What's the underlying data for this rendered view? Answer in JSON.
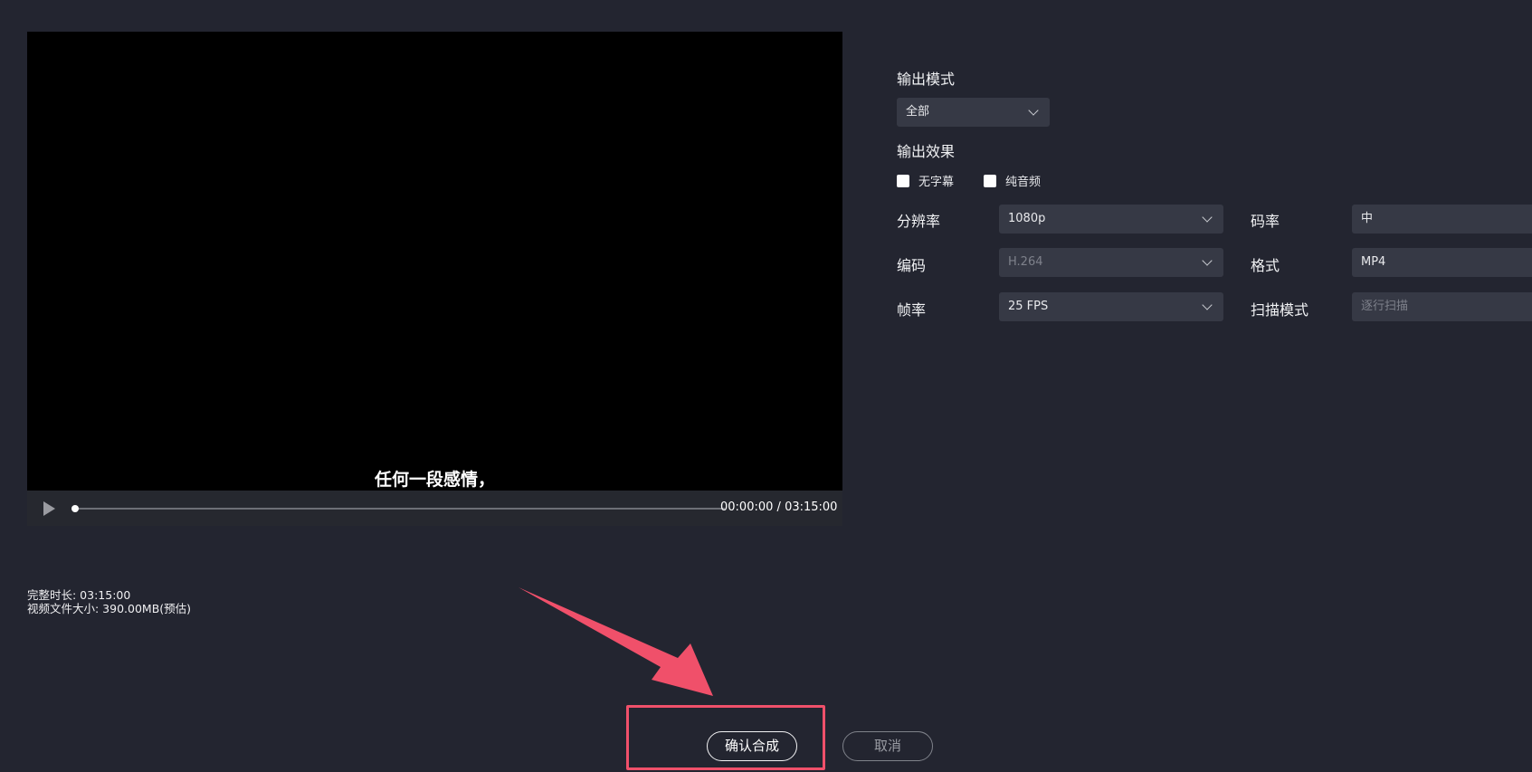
{
  "player": {
    "subtitle": "任何一段感情，",
    "time_current": "00:00:00",
    "time_separator": "/",
    "time_total": "03:15:00",
    "progress_fraction": 0.0
  },
  "info": {
    "duration": "完整时长: 03:15:00",
    "file_size": "视频文件大小: 390.00MB(预估)"
  },
  "settings": {
    "output_mode_label": "输出模式",
    "output_mode_value": "全部",
    "output_effect_label": "输出效果",
    "no_subtitle_label": "无字幕",
    "audio_only_label": "纯音频",
    "resolution_label": "分辨率",
    "resolution_value": "1080p",
    "bitrate_label": "码率",
    "bitrate_value": "中",
    "codec_label": "编码",
    "codec_value": "H.264",
    "format_label": "格式",
    "format_value": "MP4",
    "framerate_label": "帧率",
    "framerate_value": "25 FPS",
    "scan_mode_label": "扫描模式",
    "scan_mode_value": "逐行扫描"
  },
  "buttons": {
    "confirm": "确认合成",
    "cancel": "取消"
  },
  "colors": {
    "background": "#232530",
    "highlight": "#f0506a",
    "field": "#363945"
  }
}
